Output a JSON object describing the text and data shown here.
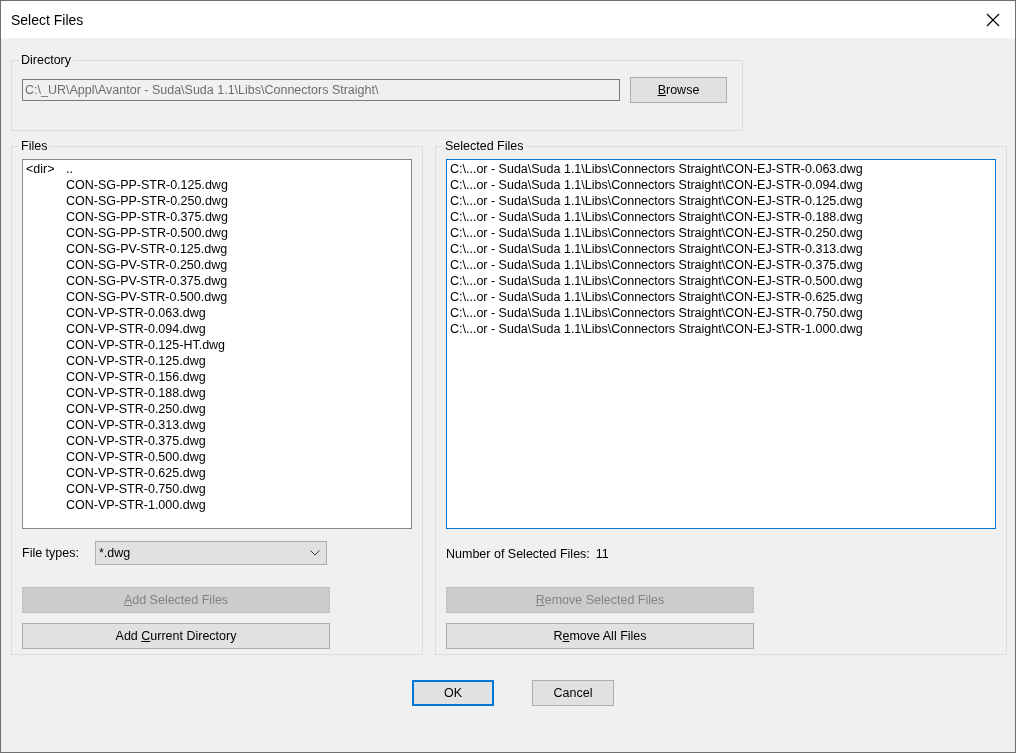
{
  "window": {
    "title": "Select Files"
  },
  "directory": {
    "label": "Directory",
    "path": "C:\\_UR\\Appl\\Avantor - Suda\\Suda 1.1\\Libs\\Connectors Straight\\",
    "browse": {
      "label": [
        {
          "text": "B",
          "underline": true
        },
        {
          "text": "rowse",
          "underline": false
        }
      ],
      "disabled": false
    }
  },
  "files": {
    "label": "Files",
    "focused": false,
    "items": [
      {
        "kind": "dir",
        "tag": "<dir>",
        "name": ".."
      },
      {
        "kind": "file",
        "name": "CON-SG-PP-STR-0.125.dwg"
      },
      {
        "kind": "file",
        "name": "CON-SG-PP-STR-0.250.dwg"
      },
      {
        "kind": "file",
        "name": "CON-SG-PP-STR-0.375.dwg"
      },
      {
        "kind": "file",
        "name": "CON-SG-PP-STR-0.500.dwg"
      },
      {
        "kind": "file",
        "name": "CON-SG-PV-STR-0.125.dwg"
      },
      {
        "kind": "file",
        "name": "CON-SG-PV-STR-0.250.dwg"
      },
      {
        "kind": "file",
        "name": "CON-SG-PV-STR-0.375.dwg"
      },
      {
        "kind": "file",
        "name": "CON-SG-PV-STR-0.500.dwg"
      },
      {
        "kind": "file",
        "name": "CON-VP-STR-0.063.dwg"
      },
      {
        "kind": "file",
        "name": "CON-VP-STR-0.094.dwg"
      },
      {
        "kind": "file",
        "name": "CON-VP-STR-0.125-HT.dwg"
      },
      {
        "kind": "file",
        "name": "CON-VP-STR-0.125.dwg"
      },
      {
        "kind": "file",
        "name": "CON-VP-STR-0.156.dwg"
      },
      {
        "kind": "file",
        "name": "CON-VP-STR-0.188.dwg"
      },
      {
        "kind": "file",
        "name": "CON-VP-STR-0.250.dwg"
      },
      {
        "kind": "file",
        "name": "CON-VP-STR-0.313.dwg"
      },
      {
        "kind": "file",
        "name": "CON-VP-STR-0.375.dwg"
      },
      {
        "kind": "file",
        "name": "CON-VP-STR-0.500.dwg"
      },
      {
        "kind": "file",
        "name": "CON-VP-STR-0.625.dwg"
      },
      {
        "kind": "file",
        "name": "CON-VP-STR-0.750.dwg"
      },
      {
        "kind": "file",
        "name": "CON-VP-STR-1.000.dwg"
      }
    ],
    "file_types": {
      "label": "File types:",
      "value": "*.dwg"
    },
    "buttons": [
      {
        "label": [
          {
            "text": "A",
            "underline": true
          },
          {
            "text": "dd Selected Files",
            "underline": false
          }
        ],
        "disabled": true
      },
      {
        "label": [
          {
            "text": "Add ",
            "underline": false
          },
          {
            "text": "C",
            "underline": true
          },
          {
            "text": "urrent Directory",
            "underline": false
          }
        ],
        "disabled": false
      }
    ]
  },
  "selected_files": {
    "label": "Selected Files",
    "focused": true,
    "items": [
      "C:\\...or - Suda\\Suda 1.1\\Libs\\Connectors Straight\\CON-EJ-STR-0.063.dwg",
      "C:\\...or - Suda\\Suda 1.1\\Libs\\Connectors Straight\\CON-EJ-STR-0.094.dwg",
      "C:\\...or - Suda\\Suda 1.1\\Libs\\Connectors Straight\\CON-EJ-STR-0.125.dwg",
      "C:\\...or - Suda\\Suda 1.1\\Libs\\Connectors Straight\\CON-EJ-STR-0.188.dwg",
      "C:\\...or - Suda\\Suda 1.1\\Libs\\Connectors Straight\\CON-EJ-STR-0.250.dwg",
      "C:\\...or - Suda\\Suda 1.1\\Libs\\Connectors Straight\\CON-EJ-STR-0.313.dwg",
      "C:\\...or - Suda\\Suda 1.1\\Libs\\Connectors Straight\\CON-EJ-STR-0.375.dwg",
      "C:\\...or - Suda\\Suda 1.1\\Libs\\Connectors Straight\\CON-EJ-STR-0.500.dwg",
      "C:\\...or - Suda\\Suda 1.1\\Libs\\Connectors Straight\\CON-EJ-STR-0.625.dwg",
      "C:\\...or - Suda\\Suda 1.1\\Libs\\Connectors Straight\\CON-EJ-STR-0.750.dwg",
      "C:\\...or - Suda\\Suda 1.1\\Libs\\Connectors Straight\\CON-EJ-STR-1.000.dwg"
    ],
    "count_label": "Number of Selected Files:",
    "count": "11",
    "buttons": [
      {
        "label": [
          {
            "text": "R",
            "underline": true
          },
          {
            "text": "emove Selected Files",
            "underline": false
          }
        ],
        "disabled": true
      },
      {
        "label": [
          {
            "text": "R",
            "underline": false
          },
          {
            "text": "e",
            "underline": true
          },
          {
            "text": "move All Files",
            "underline": false
          }
        ],
        "disabled": false
      }
    ]
  },
  "footer_buttons": [
    {
      "label": [
        {
          "text": "OK",
          "underline": false
        }
      ],
      "default": true,
      "disabled": false
    },
    {
      "label": [
        {
          "text": "Cancel",
          "underline": false
        }
      ],
      "default": false,
      "disabled": false
    }
  ]
}
